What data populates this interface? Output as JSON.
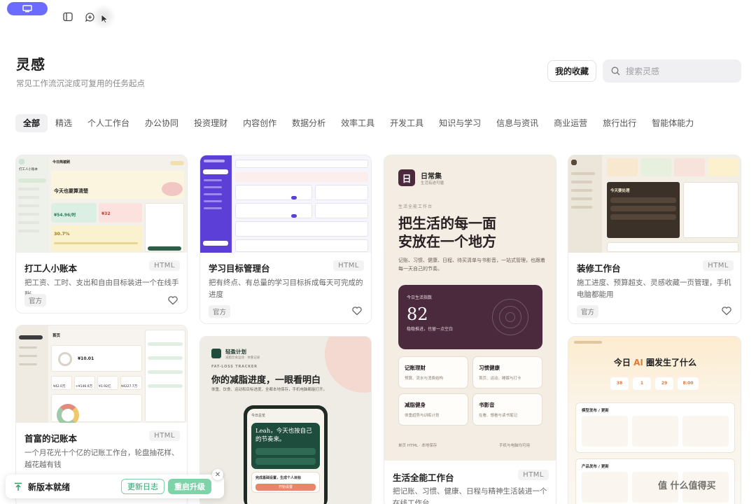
{
  "header": {
    "title": "灵感",
    "subtitle": "常见工作流沉淀成可复用的任务起点",
    "favorites_label": "我的收藏",
    "search_placeholder": "搜索灵感"
  },
  "tabs": [
    {
      "label": "全部",
      "active": true
    },
    {
      "label": "精选"
    },
    {
      "label": "个人工作台"
    },
    {
      "label": "办公协同"
    },
    {
      "label": "投资理财"
    },
    {
      "label": "内容创作"
    },
    {
      "label": "数据分析"
    },
    {
      "label": "效率工具"
    },
    {
      "label": "开发工具"
    },
    {
      "label": "知识与学习"
    },
    {
      "label": "信息与资讯"
    },
    {
      "label": "商业运营"
    },
    {
      "label": "旅行出行"
    },
    {
      "label": "智能体能力"
    }
  ],
  "cards": [
    {
      "title": "打工人小账本",
      "badge": "HTML",
      "desc": "把工资、工时、支出和自由目标装进一个在线手账",
      "tag": "官方",
      "thumb": {
        "brand": "打工人小账本",
        "greeting": "今日简被刷",
        "headline": "今天也要算清楚",
        "amount": "¥54.96/时",
        "amount2": "¥32",
        "percent": "30.7%"
      }
    },
    {
      "title": "学习目标管理台",
      "badge": "HTML",
      "desc": "把有终点、有总量的学习目标拆成每天可完成的进度",
      "tag": "官方"
    },
    {
      "title": "装修工作台",
      "badge": "HTML",
      "desc": "施工进度、预算超支、灵感收藏一页管理，手机电脑都能用",
      "tag": "官方",
      "thumb": {
        "panel_title": "今天要处理"
      }
    },
    {
      "title": "首富的记账本",
      "badge": "HTML",
      "desc": "一个月花光十个亿的记账工作台，轮盘抽花样、越花越有钱",
      "thumb": {
        "page": "首页",
        "balance": "¥10.01",
        "stats": [
          "¥42.0万",
          "+¥146.0万",
          "¥1.92亿",
          "¥4227.7万"
        ]
      }
    },
    {
      "title": "生活全能工作台",
      "badge": "HTML",
      "desc": "把记账、习惯、健康、日程与精神生活装进一个在线工作台",
      "thumb": {
        "logo_char": "日",
        "brand": "日常集",
        "brand_sub": "生活有迹可循",
        "eyebrow": "生活全能工作台",
        "headline1": "把生活的每一面",
        "headline2": "安放在一个地方",
        "intro": "记账、习惯、健康、日程、待买清单与书影音，一站式管理，也跟着每一天自己的节奏。",
        "score_label": "今日生活指数",
        "score": "82",
        "score_note": "稳稳推进，也留一点空白",
        "features": [
          {
            "title": "记账理财",
            "desc": "预算、流水与消费结构"
          },
          {
            "title": "习惯健康",
            "desc": "首页、运动、睡眠与打卡"
          },
          {
            "title": "减脂健身",
            "desc": "体重趋势与训练计划"
          },
          {
            "title": "书影音",
            "desc": "在看、想看与读书笔记"
          }
        ],
        "footer_left": "单页 HTML · 本地保存",
        "footer_right": "手机与电脑均可用"
      }
    },
    {
      "thumb": {
        "brand": "轻盈计划",
        "brand_sub": "减脂饮食运动 · 体重记录",
        "eyebrow": "FAT-LOSS TRACKER",
        "headline": "你的减脂进度，一眼看明白",
        "desc": "体重、饮食、运动和目标进度，全都本地保存，手机电脑都能打开。",
        "phone_header": "今日总览",
        "phone_card": "Leah，今天也按自己的节奏来。",
        "phone_pill": "完成基础设置，生成个人目标",
        "phone_button": "开始设置"
      }
    },
    {
      "thumb": {
        "headline_pre": "今日 ",
        "headline_ai": "AI",
        "headline_post": " 圈发生了什么",
        "stats": [
          "38",
          "1",
          "29",
          "8:00"
        ],
        "section1": "模型发布 / 更新",
        "section2": "产品发布 / 更新"
      }
    }
  ],
  "update_bar": {
    "text": "新版本就绪",
    "log_label": "更新日志",
    "upgrade_label": "重启升级"
  },
  "watermark": "值 什么值得买",
  "colors": {
    "accent": "#6b6bff",
    "plum": "#4a2a3c",
    "green": "#7fd3a9",
    "forest": "#1f4d3d",
    "sand": "#f3ede4"
  }
}
